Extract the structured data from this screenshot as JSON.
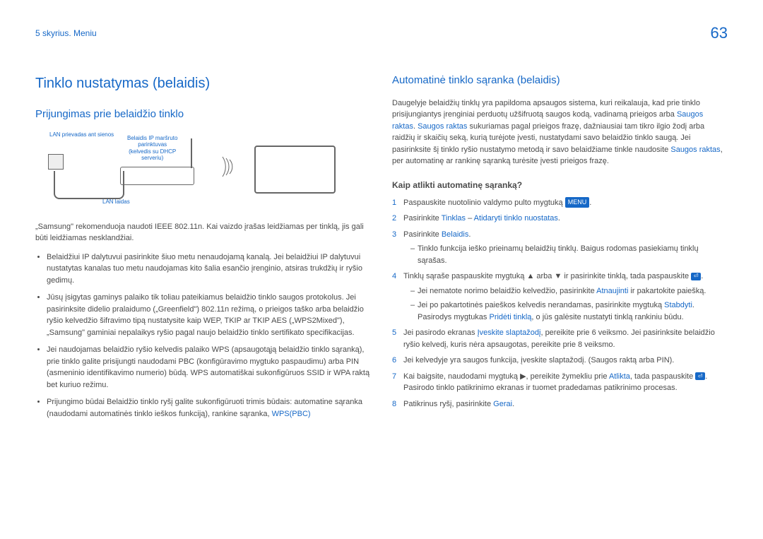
{
  "header": {
    "breadcrumb": "5 skyrius. Meniu",
    "page": "63"
  },
  "left": {
    "title": "Tinklo nustatymas (belaidis)",
    "sub": "Prijungimas prie belaidžio tinklo",
    "diag": {
      "lbl1": "LAN prievadas ant sienos",
      "lbl2a": "Belaidis IP maršruto",
      "lbl2b": "parinktuvas",
      "lbl2c": "(kelvedis su DHCP",
      "lbl2d": "serveriu)",
      "lbl3": "LAN laidas"
    },
    "p1": "„Samsung\" rekomenduoja naudoti IEEE 802.11n. Kai vaizdo įrašas leidžiamas per tinklą, jis gali būti leidžiamas nesklandžiai.",
    "b1": "Belaidžiui IP dalytuvui pasirinkite šiuo metu nenaudojamą kanalą. Jei belaidžiui IP dalytuvui nustatytas kanalas tuo metu naudojamas kito šalia esančio įrenginio, atsiras trukdžių ir ryšio gedimų.",
    "b2": "Jūsų įsigytas gaminys palaiko tik toliau pateikiamus belaidžio tinklo saugos protokolus. Jei pasirinksite didelio pralaidumo („Greenfield\") 802.11n režimą, o prieigos taško arba belaidžio ryšio kelvedžio šifravimo tipą nustatysite kaip WEP, TKIP ar TKIP AES („WPS2Mixed\"), „Samsung\" gaminiai nepalaikys ryšio pagal naujo belaidžio tinklo sertifikato specifikacijas.",
    "b3": "Jei naudojamas belaidžio ryšio kelvedis palaiko WPS (apsaugotąją belaidžio tinklo sąranką), prie tinklo galite prisijungti naudodami PBC (konfigūravimo mygtuko paspaudimu) arba PIN (asmeninio identifikavimo numerio) būdą. WPS automatiškai sukonfigūruos SSID ir WPA raktą bet kuriuo režimu.",
    "b4a": "Prijungimo būdai Belaidžio tinklo ryšį galite sukonfigūruoti trimis būdais: automatine sąranka (naudodami automatinės tinklo ieškos funkciją), rankine sąranka,",
    "b4b": "WPS(PBC)"
  },
  "right": {
    "title": "Automatinė tinklo sąranka (belaidis)",
    "p1a": "Daugelyje belaidžių tinklų yra papildoma apsaugos sistema, kuri reikalauja, kad prie tinklo prisijungiantys įrenginiai perduotų užšifruotą saugos kodą, vadinamą prieigos arba ",
    "p1b": "Saugos raktas",
    "p1c": ". ",
    "p1d": "Saugos raktas",
    "p1e": " sukuriamas pagal prieigos frazę, dažniausiai tam tikro ilgio žodį arba raidžių ir skaičių seką, kurią turėjote įvesti, nustatydami savo belaidžio tinklo saugą. Jei pasirinksite šį tinklo ryšio nustatymo metodą ir savo belaidžiame tinkle naudosite ",
    "p1f": "Saugos raktas",
    "p1g": ", per automatinę ar rankinę sąranką turėsite įvesti prieigos frazę.",
    "h3": "Kaip atlikti automatinę sąranką?",
    "s1a": "Paspauskite nuotolinio valdymo pulto mygtuką",
    "s1b": "MENU",
    "s2a": "Pasirinkite ",
    "s2b": "Tinklas",
    "s2c": " – ",
    "s2d": "Atidaryti tinklo nuostatas",
    "s3a": "Pasirinkite",
    "s3b": "Belaidis",
    "s3d": "Tinklo funkcija ieško prieinamų belaidžių tinklų. Baigus rodomas pasiekiamų tinklų sąrašas.",
    "s4a": "Tinklų sąraše paspauskite mygtuką ▲ arba ▼ ir pasirinkite tinklą, tada paspauskite",
    "s4da": "Jei nematote norimo belaidžio kelvedžio, pasirinkite ",
    "s4db": "Atnaujinti",
    "s4dc": " ir pakartokite paiešką.",
    "s4ea": "Jei po pakartotinės paieškos kelvedis nerandamas, pasirinkite mygtuką ",
    "s4eb": "Stabdyti",
    "s4ec": ". Pasirodys mygtukas ",
    "s4ed": "Pridėti tinklą",
    "s4ee": ", o jūs galėsite nustatyti tinklą rankiniu būdu.",
    "s5a": "Jei pasirodo ekranas ",
    "s5b": "Įveskite slaptažodį",
    "s5c": ", pereikite prie 6 veiksmo. Jei pasirinksite belaidžio ryšio kelvedį, kuris nėra apsaugotas, pereikite prie 8 veiksmo.",
    "s6": "Jei kelvedyje yra saugos funkcija, įveskite slaptažodį. (Saugos raktą arba PIN).",
    "s7a": "Kai baigsite, naudodami mygtuką ▶, pereikite žymekliu prie ",
    "s7b": "Atlikta",
    "s7c": ", tada paspauskite",
    "s7d": "Pasirodo tinklo patikrinimo ekranas ir tuomet pradedamas patikrinimo procesas.",
    "s8a": "Patikrinus ryšį, pasirinkite ",
    "s8b": "Gerai"
  }
}
